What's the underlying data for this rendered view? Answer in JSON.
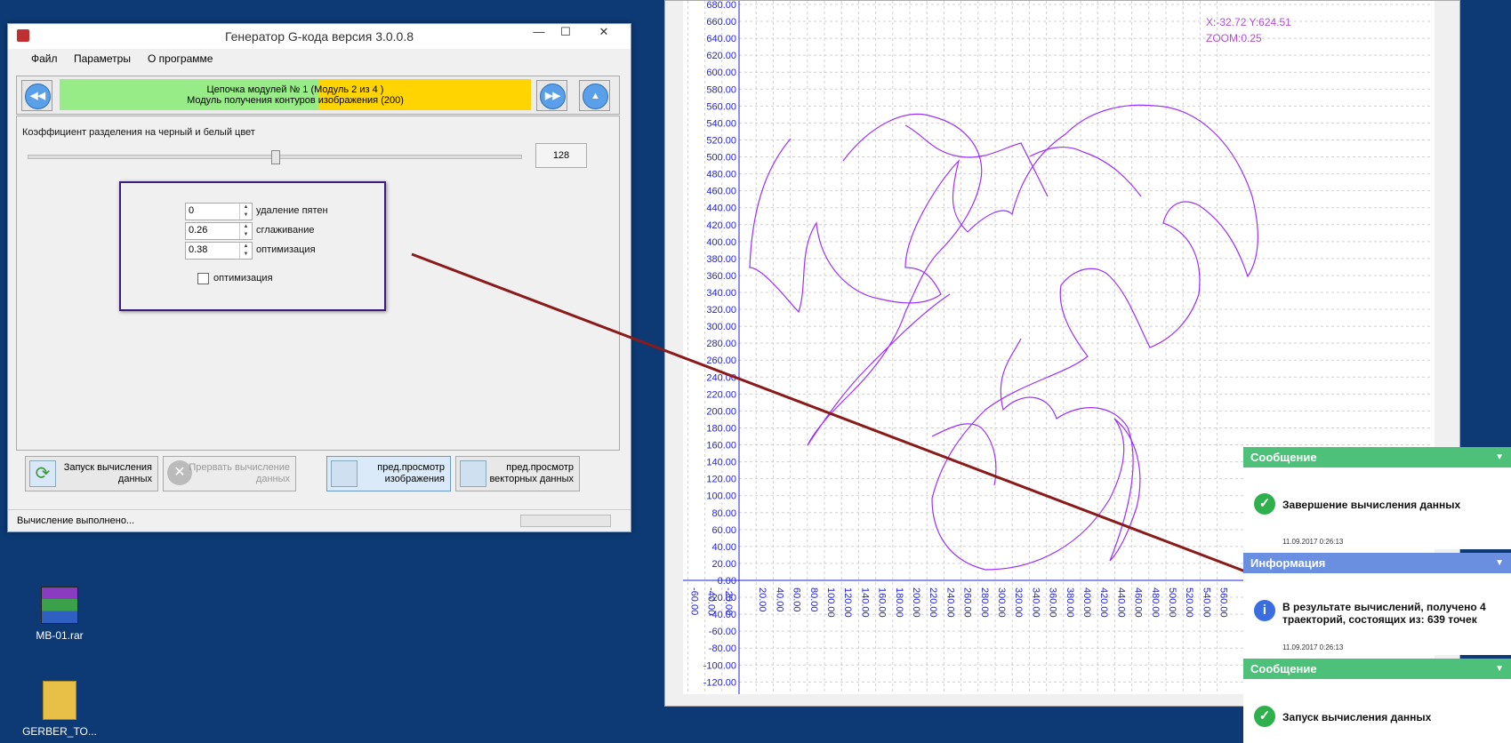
{
  "desktop": {
    "icons": [
      {
        "label": "MB-01.rar"
      },
      {
        "label": "GERBER_TO..."
      }
    ]
  },
  "app": {
    "title": "Генератор G-кода версия 3.0.0.8",
    "minimize": "—",
    "maximize": "☐",
    "close": "✕",
    "menu": [
      "Файл",
      "Параметры",
      "О программе"
    ],
    "module_line1": "Цепочка модулей № 1 (Модуль 2 из 4 )",
    "module_line2": "Модуль получения контуров изображения (200)",
    "threshold_label": "Коэффициент разделения на черный и белый цвет",
    "threshold_value": "128",
    "threshold_level": 0.5,
    "params": [
      {
        "value": "0",
        "label": "удаление пятен"
      },
      {
        "value": "0.26",
        "label": "сглаживание"
      },
      {
        "value": "0.38",
        "label": "оптимизация"
      }
    ],
    "checkbox_label": "оптимизация",
    "buttons": {
      "start": "Запуск вычисления данных",
      "start_l1": "Запуск вычисления",
      "start_l2": "данных",
      "stop_l1": "Прервать вычисление",
      "stop_l2": "данных",
      "preview_img_l1": "пред.просмотр",
      "preview_img_l2": "изображения",
      "preview_vec_l1": "пред.просмотр",
      "preview_vec_l2": "векторных данных"
    },
    "status": "Вычисление выполнено..."
  },
  "plot": {
    "coords": "X:-32.72 Y:624.51",
    "zoom": "ZOOM:0.25",
    "y_ticks": [
      "680.00",
      "660.00",
      "640.00",
      "620.00",
      "600.00",
      "580.00",
      "560.00",
      "540.00",
      "520.00",
      "500.00",
      "480.00",
      "460.00",
      "440.00",
      "420.00",
      "400.00",
      "380.00",
      "360.00",
      "340.00",
      "320.00",
      "300.00",
      "280.00",
      "260.00",
      "240.00",
      "220.00",
      "200.00",
      "180.00",
      "160.00",
      "140.00",
      "120.00",
      "100.00",
      "80.00",
      "60.00",
      "40.00",
      "20.00",
      "0.00",
      "-20.00",
      "-40.00",
      "-60.00",
      "-80.00",
      "-100.00",
      "-120.00"
    ],
    "x_ticks": [
      "-60.00",
      "-40.00",
      "-20.00",
      "20.00",
      "40.00",
      "60.00",
      "80.00",
      "100.00",
      "120.00",
      "140.00",
      "160.00",
      "180.00",
      "200.00",
      "220.00",
      "240.00",
      "260.00",
      "280.00",
      "300.00",
      "320.00",
      "340.00",
      "360.00",
      "380.00",
      "400.00",
      "420.00",
      "440.00",
      "460.00",
      "480.00",
      "500.00",
      "520.00",
      "540.00",
      "560.00"
    ],
    "accent": "#9b30ff",
    "axis_color": "#2222dd"
  },
  "notifications": [
    {
      "header": "Сообщение",
      "color": "#4dc07a",
      "icon": "check-icon",
      "message": "Завершение вычисления данных",
      "time": "11.09.2017 0:26:13"
    },
    {
      "header": "Информация",
      "color": "#6b8fe0",
      "icon": "info-icon",
      "message": "В результате вычислений, получено 4 траекторий, состоящих из: 639 точек",
      "time": "11.09.2017 0:26:13"
    },
    {
      "header": "Сообщение",
      "color": "#4dc07a",
      "icon": "check-icon",
      "message": "Запуск вычисления данных",
      "time": ""
    }
  ]
}
